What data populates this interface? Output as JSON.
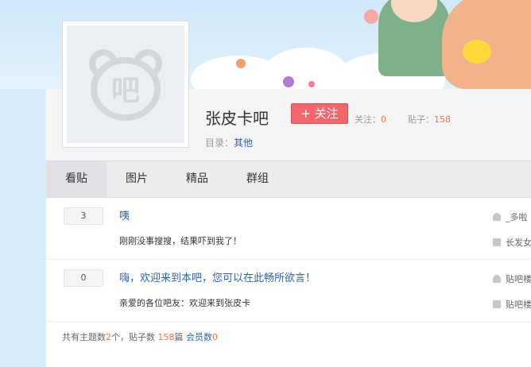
{
  "forum": {
    "avatar_glyph": "吧",
    "name": "张皮卡吧",
    "follow_label": "+ 关注",
    "followers_label": "关注：",
    "followers_count": "0",
    "posts_label": "贴子：",
    "posts_count": "158",
    "category_label": "目录：",
    "category_value": "其他"
  },
  "tabs": [
    {
      "label": "看贴",
      "active": true
    },
    {
      "label": "图片",
      "active": false
    },
    {
      "label": "精品",
      "active": false
    },
    {
      "label": "群组",
      "active": false
    }
  ],
  "threads": [
    {
      "reply_count": "3",
      "title": "咦",
      "excerpt": "刚刚没事搜搜，结果吓到我了！",
      "author": "_多啦",
      "last_reply": "长发女"
    },
    {
      "reply_count": "0",
      "title": "嗨，欢迎来到本吧，您可以在此畅所欲言！",
      "excerpt": "亲爱的各位吧友：欢迎来到张皮卡",
      "author": "贴吧楼",
      "last_reply": "贴吧楼"
    }
  ],
  "footer": {
    "prefix": "共有主题数",
    "topics": "2",
    "topics_unit": "个，贴子数 ",
    "posts": "158",
    "posts_unit": "篇 ",
    "members_label": "会员数",
    "members": "0"
  },
  "colors": {
    "accent_blue": "#2d64b3",
    "follow_red": "#f2666c",
    "count_orange": "#f0734b"
  }
}
